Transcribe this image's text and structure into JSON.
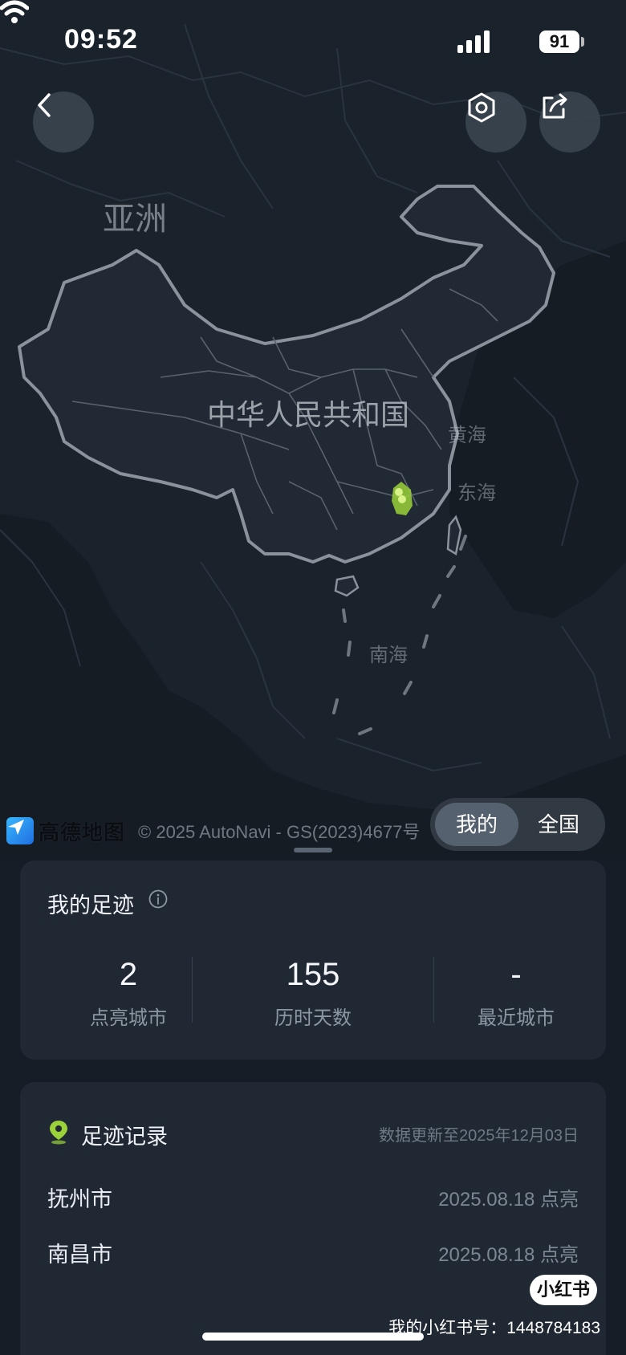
{
  "status_bar": {
    "time": "09:52",
    "battery": "91"
  },
  "map": {
    "labels": {
      "asia": "亚洲",
      "china": "中华人民共和国",
      "yellow_sea": "黄海",
      "east_sea": "东海",
      "south_sea": "南海"
    },
    "provider": "高德地图",
    "copyright": "© 2025 AutoNavi - GS(2023)4677号",
    "marker_color": "#9bd13a"
  },
  "toggle": {
    "mine": "我的",
    "nationwide": "全国",
    "selected": "mine"
  },
  "stats_card": {
    "title": "我的足迹",
    "items": [
      {
        "value": "2",
        "label": "点亮城市"
      },
      {
        "value": "155",
        "label": "历时天数"
      },
      {
        "value": "-",
        "label": "最近城市"
      }
    ]
  },
  "records_card": {
    "title": "足迹记录",
    "updated": "数据更新至2025年12月03日",
    "rows": [
      {
        "city": "抚州市",
        "date": "2025.08.18 点亮"
      },
      {
        "city": "南昌市",
        "date": "2025.08.18 点亮"
      }
    ]
  },
  "watermark": {
    "badge": "小红书",
    "id": "我的小红书号：1448784183"
  },
  "colors": {
    "accent": "#9bd13a",
    "card": "#1f2833",
    "background": "#161d26"
  }
}
